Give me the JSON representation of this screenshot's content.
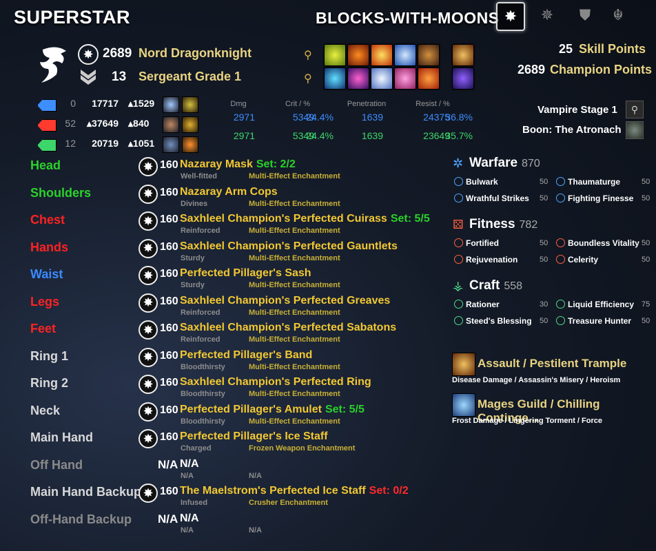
{
  "character_name": "SUPERSTAR",
  "account_name": "BLOCKS-WITH-MOONS",
  "info": {
    "cp": "2689",
    "race_class": "Nord Dragonknight",
    "rank": "13",
    "rank_title": "Sergeant Grade 1"
  },
  "right_summary": {
    "skill_points": "25",
    "skill_points_label": "Skill Points",
    "champion_points": "2689",
    "champion_points_label": "Champion Points",
    "vampire": "Vampire Stage 1",
    "boon": "Boon: The Atronach"
  },
  "resources": [
    {
      "base": "0",
      "value": "17717",
      "recovery": "1529"
    },
    {
      "base": "52",
      "value": "37649",
      "recovery": "840"
    },
    {
      "base": "12",
      "value": "20719",
      "recovery": "1051"
    }
  ],
  "stat_headers": {
    "dmg": "Dmg",
    "crit": "Crit / %",
    "pen": "Penetration",
    "resist": "Resist / %"
  },
  "stat_rows": [
    {
      "dmg": "2971",
      "crit": "5349",
      "crit_pct": "24.4%",
      "pen": "1639",
      "resist": "24375",
      "resist_pct": "36.8%"
    },
    {
      "dmg": "2971",
      "crit": "5349",
      "crit_pct": "24.4%",
      "pen": "1639",
      "resist": "23649",
      "resist_pct": "35.7%"
    }
  ],
  "gear": [
    {
      "slot": "Head",
      "level": "160",
      "item": "Nazaray Mask",
      "set": "Set: 2/2",
      "trait": "Well-fitted",
      "enchant": "Multi-Effect Enchantment"
    },
    {
      "slot": "Shoulders",
      "level": "160",
      "item": "Nazaray Arm Cops",
      "set": "",
      "trait": "Divines",
      "enchant": "Multi-Effect Enchantment"
    },
    {
      "slot": "Chest",
      "level": "160",
      "item": "Saxhleel Champion's Perfected Cuirass",
      "set": "Set: 5/5",
      "trait": "Reinforced",
      "enchant": "Multi-Effect Enchantment"
    },
    {
      "slot": "Hands",
      "level": "160",
      "item": "Saxhleel Champion's Perfected Gauntlets",
      "set": "",
      "trait": "Sturdy",
      "enchant": "Multi-Effect Enchantment"
    },
    {
      "slot": "Waist",
      "level": "160",
      "item": "Perfected Pillager's Sash",
      "set": "",
      "trait": "Sturdy",
      "enchant": "Multi-Effect Enchantment"
    },
    {
      "slot": "Legs",
      "level": "160",
      "item": "Saxhleel Champion's Perfected Greaves",
      "set": "",
      "trait": "Reinforced",
      "enchant": "Multi-Effect Enchantment"
    },
    {
      "slot": "Feet",
      "level": "160",
      "item": "Saxhleel Champion's Perfected Sabatons",
      "set": "",
      "trait": "Reinforced",
      "enchant": "Multi-Effect Enchantment"
    },
    {
      "slot": "Ring 1",
      "level": "160",
      "item": "Perfected Pillager's Band",
      "set": "",
      "trait": "Bloodthirsty",
      "enchant": "Multi-Effect Enchantment"
    },
    {
      "slot": "Ring 2",
      "level": "160",
      "item": "Saxhleel Champion's Perfected Ring",
      "set": "",
      "trait": "Bloodthirsty",
      "enchant": "Multi-Effect Enchantment"
    },
    {
      "slot": "Neck",
      "level": "160",
      "item": "Perfected Pillager's Amulet",
      "set": "Set: 5/5",
      "trait": "Bloodthirsty",
      "enchant": "Multi-Effect Enchantment"
    },
    {
      "slot": "Main Hand",
      "level": "160",
      "item": "Perfected Pillager's Ice Staff",
      "set": "",
      "trait": "Charged",
      "enchant": "Frozen Weapon Enchantment"
    },
    {
      "slot": "Off Hand",
      "level": "N/A",
      "item": "N/A",
      "set": "",
      "trait": "N/A",
      "enchant": "N/A"
    },
    {
      "slot": "Main Hand Backup",
      "level": "160",
      "item": "The Maelstrom's Perfected Ice Staff",
      "set": "Set: 0/2",
      "trait": "Infused",
      "enchant": "Crusher Enchantment"
    },
    {
      "slot": "Off-Hand Backup",
      "level": "N/A",
      "item": "N/A",
      "set": "",
      "trait": "N/A",
      "enchant": "N/A"
    }
  ],
  "slot_colors": [
    "#2bd12b",
    "#2bd12b",
    "#ff2222",
    "#ff2222",
    "#3a8bff",
    "#ff2222",
    "#ff2222",
    "#d8d8d8",
    "#d8d8d8",
    "#d8d8d8",
    "#d8d8d8",
    "#8a8a8a",
    "#d8d8d8",
    "#8a8a8a"
  ],
  "set_colors": [
    "#2bd12b",
    "#2bd12b",
    "#2bd12b",
    "#2bd12b",
    "#2bd12b",
    "#2bd12b",
    "#2bd12b",
    "#2bd12b",
    "#2bd12b",
    "#2bd12b",
    "#2bd12b",
    "#2bd12b",
    "#ff2a2a",
    "#2bd12b"
  ],
  "champion": {
    "warfare": {
      "name": "Warfare",
      "points": "870",
      "stars": [
        {
          "name": "Bulwark",
          "value": "50"
        },
        {
          "name": "Thaumaturge",
          "value": "50"
        },
        {
          "name": "Wrathful Strikes",
          "value": "50"
        },
        {
          "name": "Fighting Finesse",
          "value": "50"
        }
      ]
    },
    "fitness": {
      "name": "Fitness",
      "points": "782",
      "stars": [
        {
          "name": "Fortified",
          "value": "50"
        },
        {
          "name": "Boundless Vitality",
          "value": "50"
        },
        {
          "name": "Rejuvenation",
          "value": "50"
        },
        {
          "name": "Celerity",
          "value": "50"
        }
      ]
    },
    "craft": {
      "name": "Craft",
      "points": "558",
      "stars": [
        {
          "name": "Rationer",
          "value": "30"
        },
        {
          "name": "Liquid Efficiency",
          "value": "75"
        },
        {
          "name": "Steed's Blessing",
          "value": "50"
        },
        {
          "name": "Treasure Hunter",
          "value": "50"
        }
      ]
    }
  },
  "skill_lines": [
    {
      "title": "Assault / Pestilent Trample",
      "sub": "Disease Damage / Assassin's Misery / Heroism"
    },
    {
      "title": "Mages Guild / Chilling Continge...",
      "sub": "Frost Damage / Lingering Torment / Force"
    }
  ],
  "colors": {
    "health": "#ff3b30",
    "magicka": "#3d8eff",
    "stamina": "#3dd66b",
    "item": "#f2c832",
    "enchant": "#c9b036"
  }
}
